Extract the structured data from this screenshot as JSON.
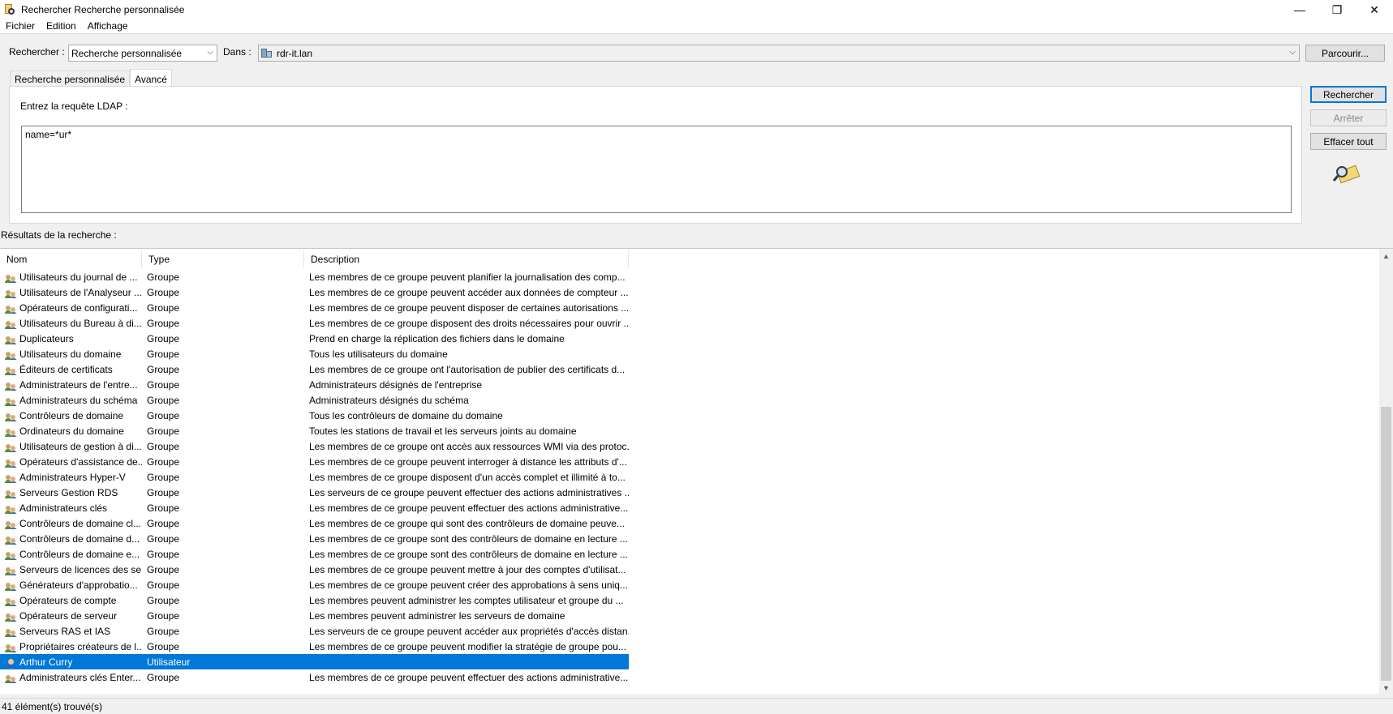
{
  "window": {
    "title": "Rechercher Recherche personnalisée",
    "minimize": "—",
    "restore": "❐",
    "close": "✕"
  },
  "menu": [
    "Fichier",
    "Edition",
    "Affichage"
  ],
  "search_bar": {
    "find_label": "Rechercher :",
    "find_value": "Recherche personnalisée",
    "in_label": "Dans :",
    "in_value": "rdr-it.lan",
    "browse_button": "Parcourir..."
  },
  "tabs": [
    {
      "label": "Recherche personnalisée",
      "active": false
    },
    {
      "label": "Avancé",
      "active": true
    }
  ],
  "ldap": {
    "label": "Entrez la requête LDAP :",
    "query": "name=*ur*"
  },
  "actions": {
    "search": "Rechercher",
    "stop": "Arrêter",
    "clear": "Effacer tout"
  },
  "results": {
    "label": "Résultats de la recherche :",
    "columns": [
      "Nom",
      "Type",
      "Description"
    ],
    "rows": [
      {
        "name": "Utilisateurs du journal de ...",
        "type": "Groupe",
        "desc": "Les membres de ce groupe peuvent planifier la journalisation des comp...",
        "icon": "group-icon"
      },
      {
        "name": "Utilisateurs de l'Analyseur ...",
        "type": "Groupe",
        "desc": "Les membres de ce groupe peuvent accéder aux données de compteur ...",
        "icon": "group-icon"
      },
      {
        "name": "Opérateurs de configurati...",
        "type": "Groupe",
        "desc": "Les membres de ce groupe peuvent disposer de certaines autorisations ...",
        "icon": "group-icon"
      },
      {
        "name": "Utilisateurs du Bureau à di...",
        "type": "Groupe",
        "desc": "Les membres de ce groupe disposent des droits nécessaires pour ouvrir ...",
        "icon": "group-icon"
      },
      {
        "name": "Duplicateurs",
        "type": "Groupe",
        "desc": "Prend en charge la réplication des fichiers dans le domaine",
        "icon": "group-icon"
      },
      {
        "name": "Utilisateurs du domaine",
        "type": "Groupe",
        "desc": "Tous les utilisateurs du domaine",
        "icon": "group-icon"
      },
      {
        "name": "Éditeurs de certificats",
        "type": "Groupe",
        "desc": "Les membres de ce groupe ont l'autorisation de publier des certificats d...",
        "icon": "group-icon"
      },
      {
        "name": "Administrateurs de l'entre...",
        "type": "Groupe",
        "desc": "Administrateurs désignés de l'entreprise",
        "icon": "group-icon"
      },
      {
        "name": "Administrateurs du schéma",
        "type": "Groupe",
        "desc": "Administrateurs désignés du schéma",
        "icon": "group-icon"
      },
      {
        "name": "Contrôleurs de domaine",
        "type": "Groupe",
        "desc": "Tous les contrôleurs de domaine du domaine",
        "icon": "group-icon"
      },
      {
        "name": "Ordinateurs du domaine",
        "type": "Groupe",
        "desc": "Toutes les stations de travail et les serveurs joints au domaine",
        "icon": "group-icon"
      },
      {
        "name": "Utilisateurs de gestion à di...",
        "type": "Groupe",
        "desc": "Les membres de ce groupe ont accès aux ressources WMI via des protoc...",
        "icon": "group-icon"
      },
      {
        "name": "Opérateurs d'assistance de...",
        "type": "Groupe",
        "desc": "Les membres de ce groupe peuvent interroger à distance les attributs d'...",
        "icon": "group-icon"
      },
      {
        "name": "Administrateurs Hyper-V",
        "type": "Groupe",
        "desc": "Les membres de ce groupe disposent d'un accès complet et illimité à to...",
        "icon": "group-icon"
      },
      {
        "name": "Serveurs Gestion RDS",
        "type": "Groupe",
        "desc": "Les serveurs de ce groupe peuvent effectuer des actions administratives ...",
        "icon": "group-icon"
      },
      {
        "name": "Administrateurs clés",
        "type": "Groupe",
        "desc": "Les membres de ce groupe peuvent effectuer des actions administrative...",
        "icon": "group-icon"
      },
      {
        "name": "Contrôleurs de domaine cl...",
        "type": "Groupe",
        "desc": "Les membres de ce groupe qui sont des contrôleurs de domaine peuve...",
        "icon": "group-icon"
      },
      {
        "name": "Contrôleurs de domaine d...",
        "type": "Groupe",
        "desc": "Les membres de ce groupe sont des contrôleurs de domaine en lecture ...",
        "icon": "group-icon"
      },
      {
        "name": "Contrôleurs de domaine e...",
        "type": "Groupe",
        "desc": "Les membres de ce groupe sont des contrôleurs de domaine en lecture ...",
        "icon": "group-icon"
      },
      {
        "name": "Serveurs de licences des se...",
        "type": "Groupe",
        "desc": "Les membres de ce groupe peuvent mettre à jour des comptes d'utilisat...",
        "icon": "group-icon"
      },
      {
        "name": "Générateurs d'approbatio...",
        "type": "Groupe",
        "desc": "Les membres de ce groupe peuvent créer des approbations à sens uniq...",
        "icon": "group-icon"
      },
      {
        "name": "Opérateurs de compte",
        "type": "Groupe",
        "desc": "Les membres peuvent administrer les comptes utilisateur et groupe du ...",
        "icon": "group-icon"
      },
      {
        "name": "Opérateurs de serveur",
        "type": "Groupe",
        "desc": "Les membres peuvent administrer les serveurs de domaine",
        "icon": "group-icon"
      },
      {
        "name": "Serveurs RAS et IAS",
        "type": "Groupe",
        "desc": "Les serveurs de ce groupe peuvent accéder aux propriétés d'accès distan...",
        "icon": "group-icon"
      },
      {
        "name": "Propriétaires créateurs de l...",
        "type": "Groupe",
        "desc": "Les membres de ce groupe peuvent modifier la stratégie de groupe pou...",
        "icon": "group-icon"
      },
      {
        "name": "Arthur Curry",
        "type": "Utilisateur",
        "desc": "",
        "icon": "user-icon",
        "selected": true
      },
      {
        "name": "Administrateurs clés Enter...",
        "type": "Groupe",
        "desc": "Les membres de ce groupe peuvent effectuer des actions administrative...",
        "icon": "group-icon"
      }
    ]
  },
  "status": {
    "count_text": "41 élément(s) trouvé(s)"
  },
  "colors": {
    "selection": "#0078d7",
    "default_button_border": "#0078d7"
  }
}
